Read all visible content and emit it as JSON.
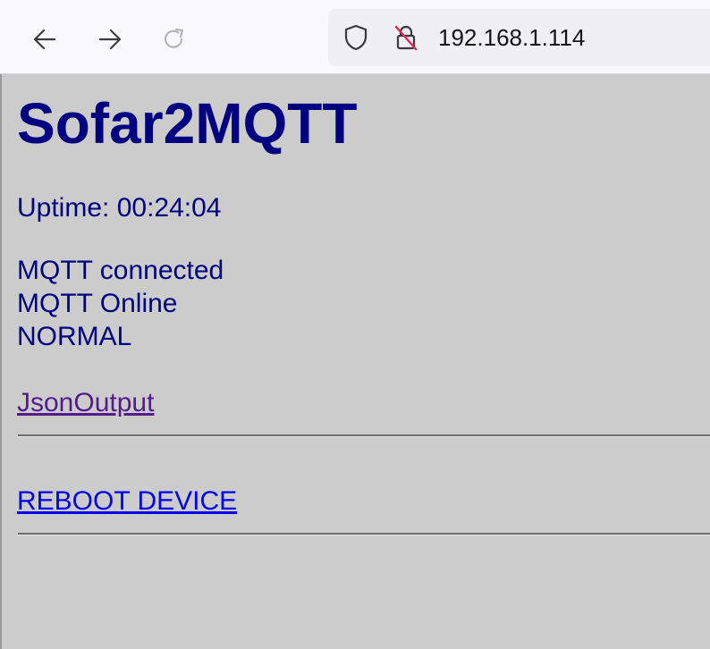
{
  "browser": {
    "url": "192.168.1.114",
    "back_icon": "arrow-left-icon",
    "forward_icon": "arrow-right-icon",
    "reload_icon": "reload-icon",
    "shield_icon": "shield-icon",
    "insecure_lock_icon": "lock-slash-icon"
  },
  "page": {
    "title": "Sofar2MQTT",
    "uptime": "Uptime: 00:24:04",
    "status_lines": [
      "MQTT connected",
      "MQTT Online",
      "NORMAL"
    ],
    "json_link": "JsonOutput",
    "reboot_link": "REBOOT DEVICE",
    "colors": {
      "background": "#cccccc",
      "text": "#000080",
      "visited_link": "#551a8b",
      "link": "#0000ee"
    }
  }
}
